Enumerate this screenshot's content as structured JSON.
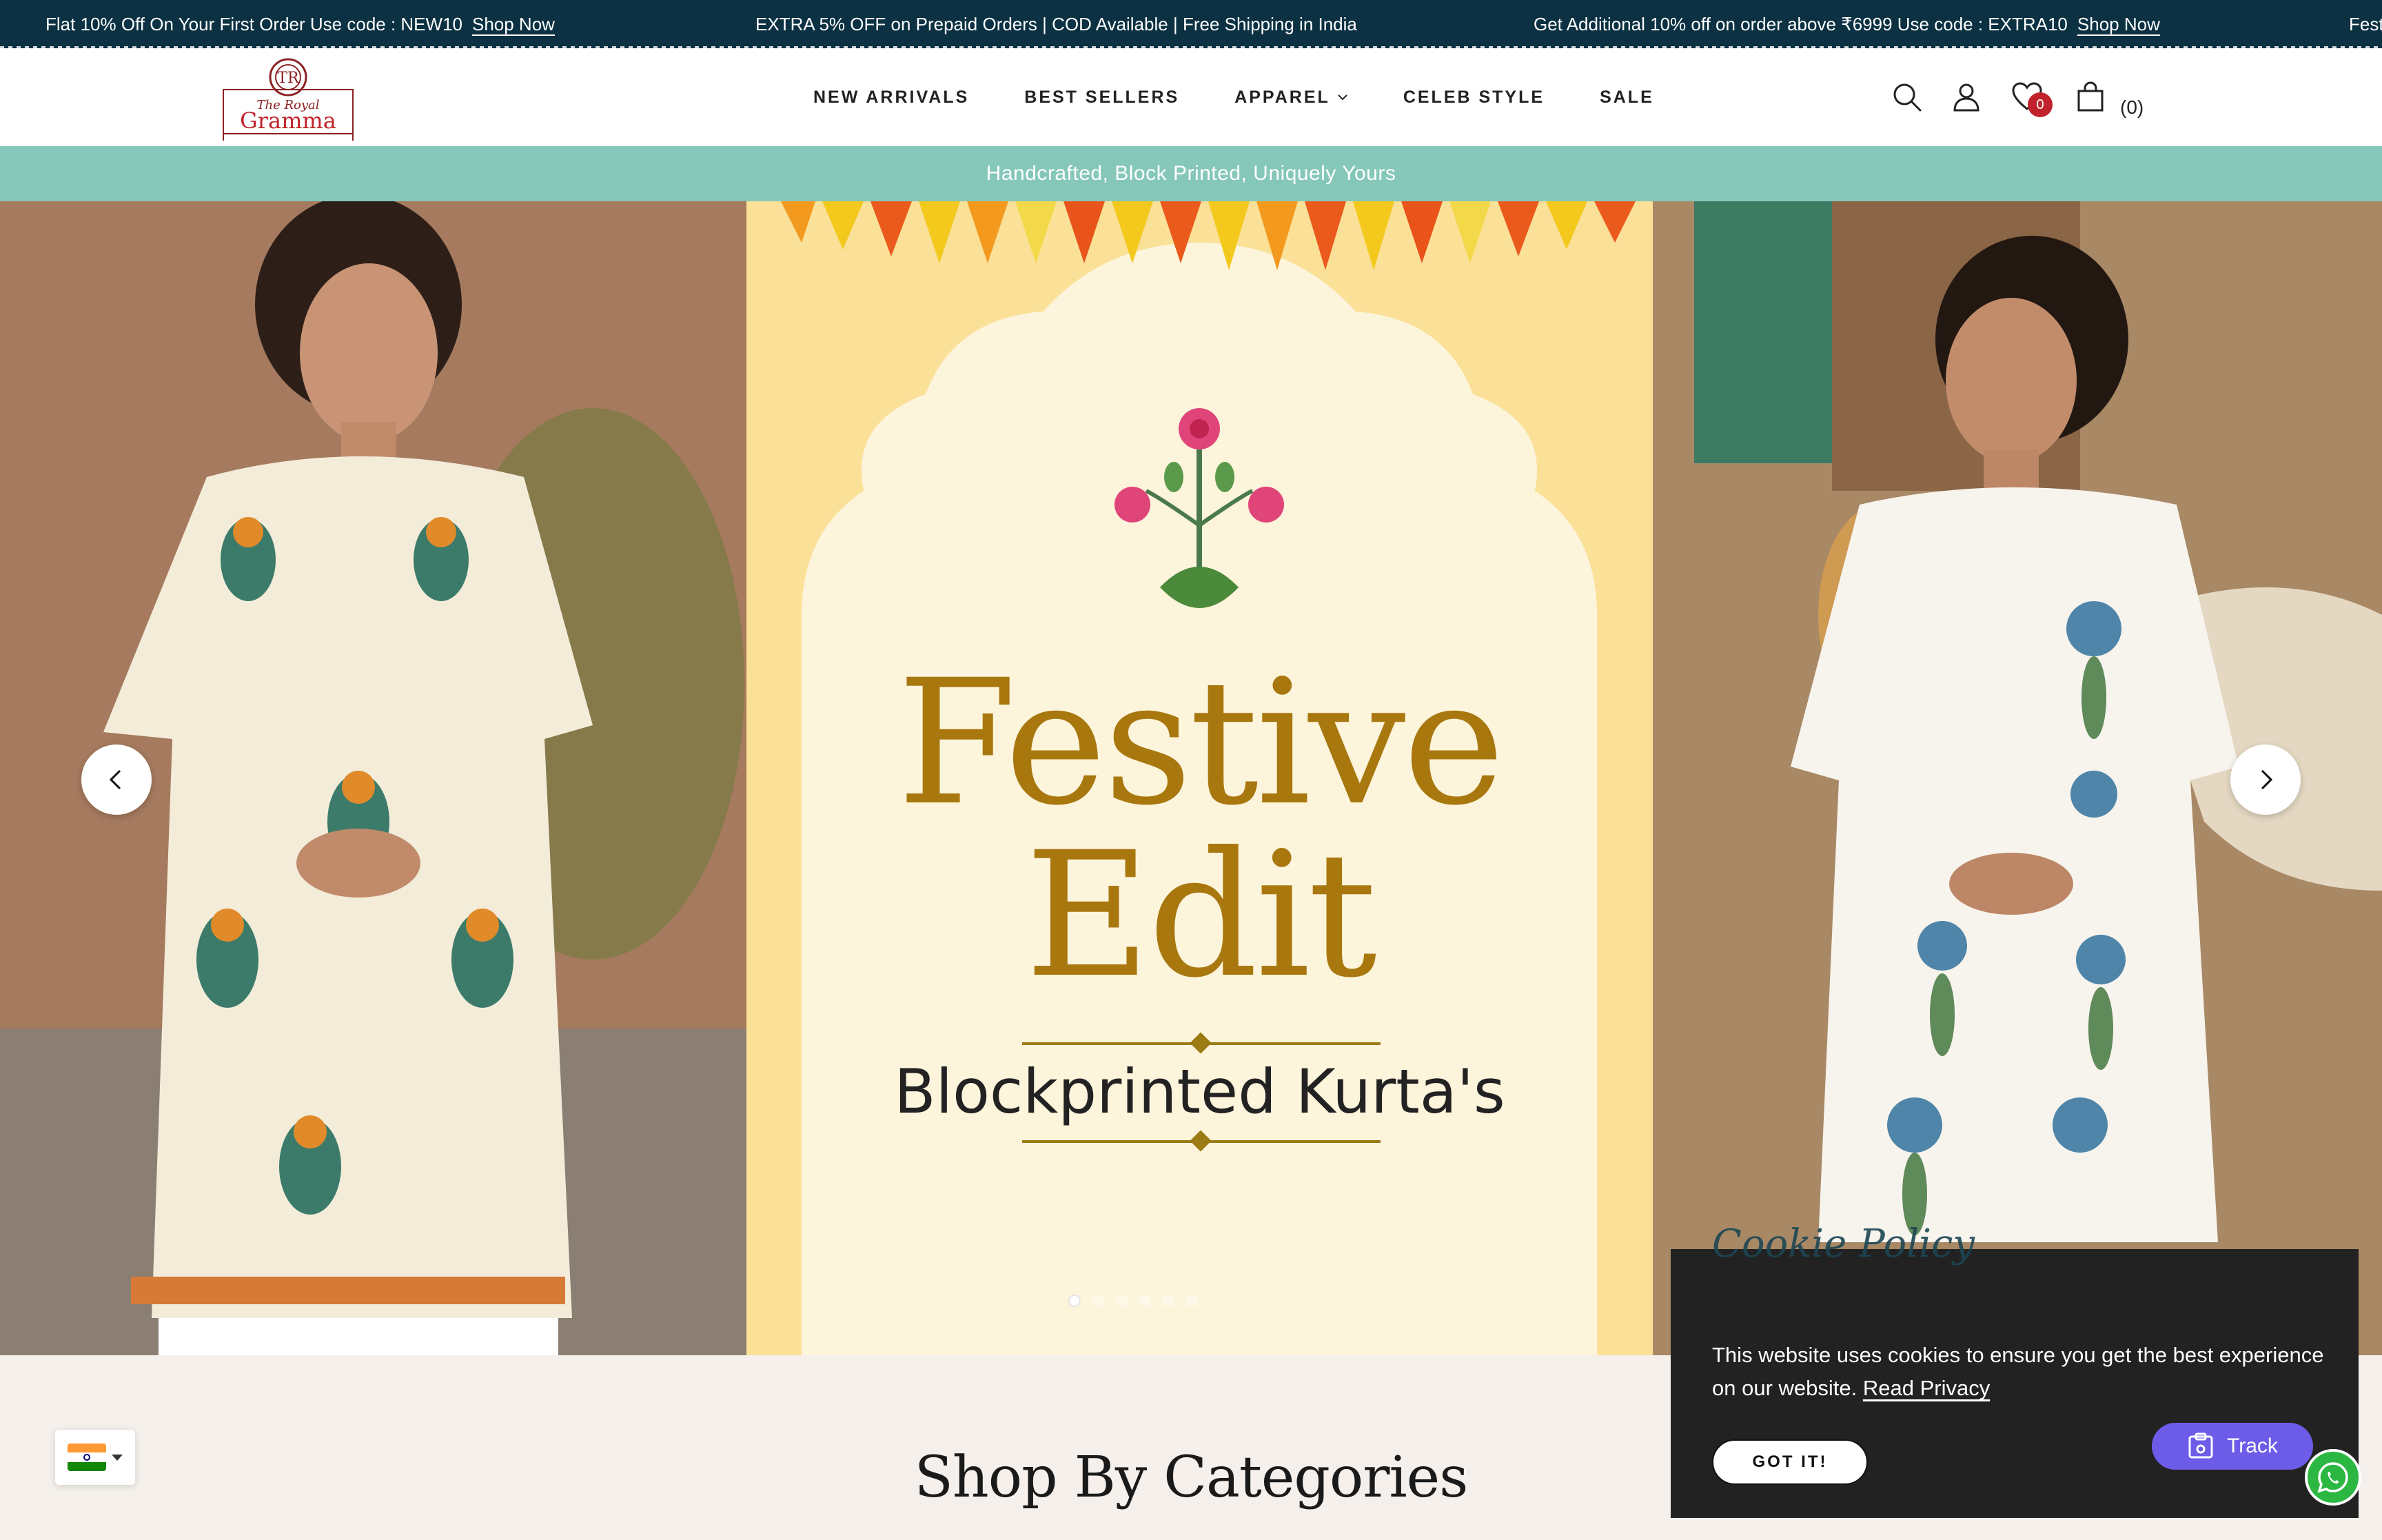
{
  "announcement": {
    "messages": [
      {
        "text": "Flat 10% Off On Your First Order Use code : NEW10",
        "link": "Shop Now"
      },
      {
        "text": "EXTRA 5% OFF on Prepaid Orders | COD Available | Free Shipping in India",
        "link": ""
      },
      {
        "text": "Get Additional 10% off on order above ₹6999 Use code : EXTRA10",
        "link": "Shop Now"
      },
      {
        "text": "Festi",
        "link": ""
      }
    ]
  },
  "header": {
    "logo_text": "The Royal Gramma",
    "nav": [
      "NEW ARRIVALS",
      "BEST SELLERS",
      "APPAREL",
      "CELEB STYLE",
      "SALE"
    ],
    "wishlist_count": "0",
    "cart_label": "(0)"
  },
  "tagline": "Handcrafted, Block Printed, Uniquely Yours",
  "hero": {
    "title_line1": "Festive",
    "title_line2": "Edit",
    "subtitle": "Blockprinted Kurta's",
    "slide_count": 6,
    "active_slide": 1
  },
  "categories": {
    "title": "Shop By Categories"
  },
  "cookie": {
    "heading": "Cookie Policy",
    "text": "This website uses cookies to ensure you get the best experience on our website.",
    "link": "Read Privacy",
    "button": "GOT IT!"
  },
  "track": {
    "label": "Track"
  },
  "colors": {
    "announcement_bg": "#0b3142",
    "tagline_bg": "#85c7b9",
    "hero_gold": "#a8780f",
    "wishlist_badge": "#c0232b",
    "track_button": "#6d5ce8",
    "whatsapp": "#2bb741",
    "cookie_bg": "#222222"
  }
}
